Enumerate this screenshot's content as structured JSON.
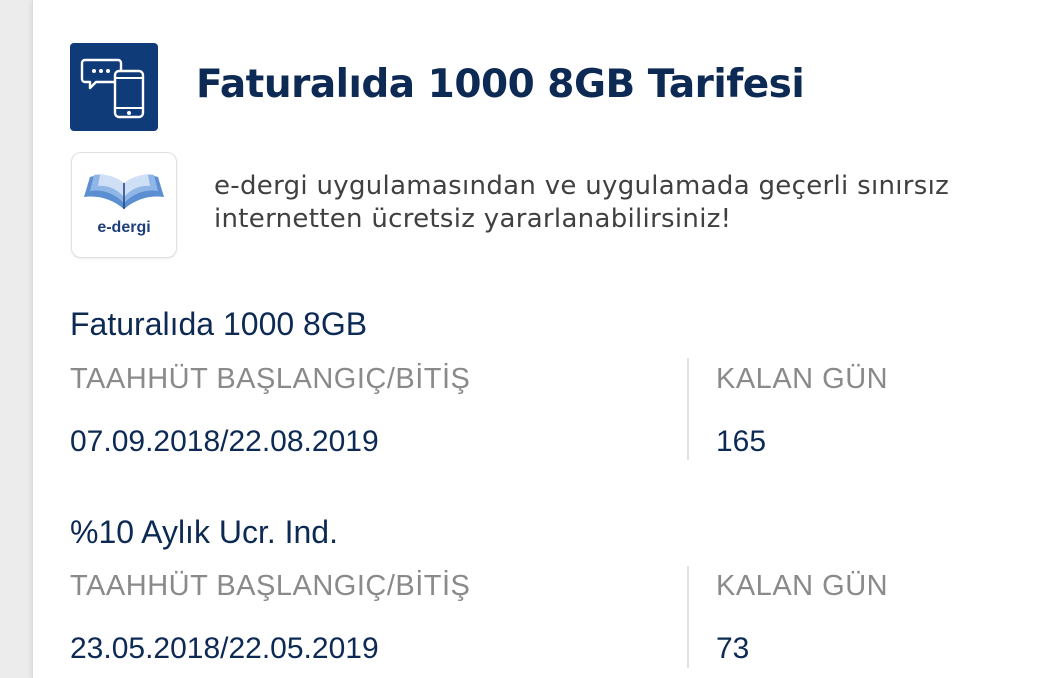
{
  "header": {
    "icon": "chat-phone-icon",
    "title": "Faturalıda 1000 8GB Tarifesi"
  },
  "promo": {
    "logo_icon": "edergi-book-icon",
    "logo_text": "e-dergi",
    "text": "e-dergi uygulamasından ve uygulamada geçerli sınırsız internetten ücretsiz yararlanabilirsiniz!"
  },
  "commitments": [
    {
      "name": "Faturalıda 1000 8GB",
      "dates_label": "TAAHHÜT BAŞLANGIÇ/BİTİŞ",
      "dates_value": "07.09.2018/22.08.2019",
      "days_label": "KALAN GÜN",
      "days_value": "165"
    },
    {
      "name": "%10 Aylık Ucr. Ind.",
      "dates_label": "TAAHHÜT BAŞLANGIÇ/BİTİŞ",
      "dates_value": "23.05.2018/22.05.2019",
      "days_label": "KALAN GÜN",
      "days_value": "73"
    }
  ],
  "colors": {
    "brand_navy": "#0f3b78",
    "title_text": "#0d2a54",
    "label_gray": "#8a8a8a",
    "book_blue": "#5b8fd1"
  }
}
